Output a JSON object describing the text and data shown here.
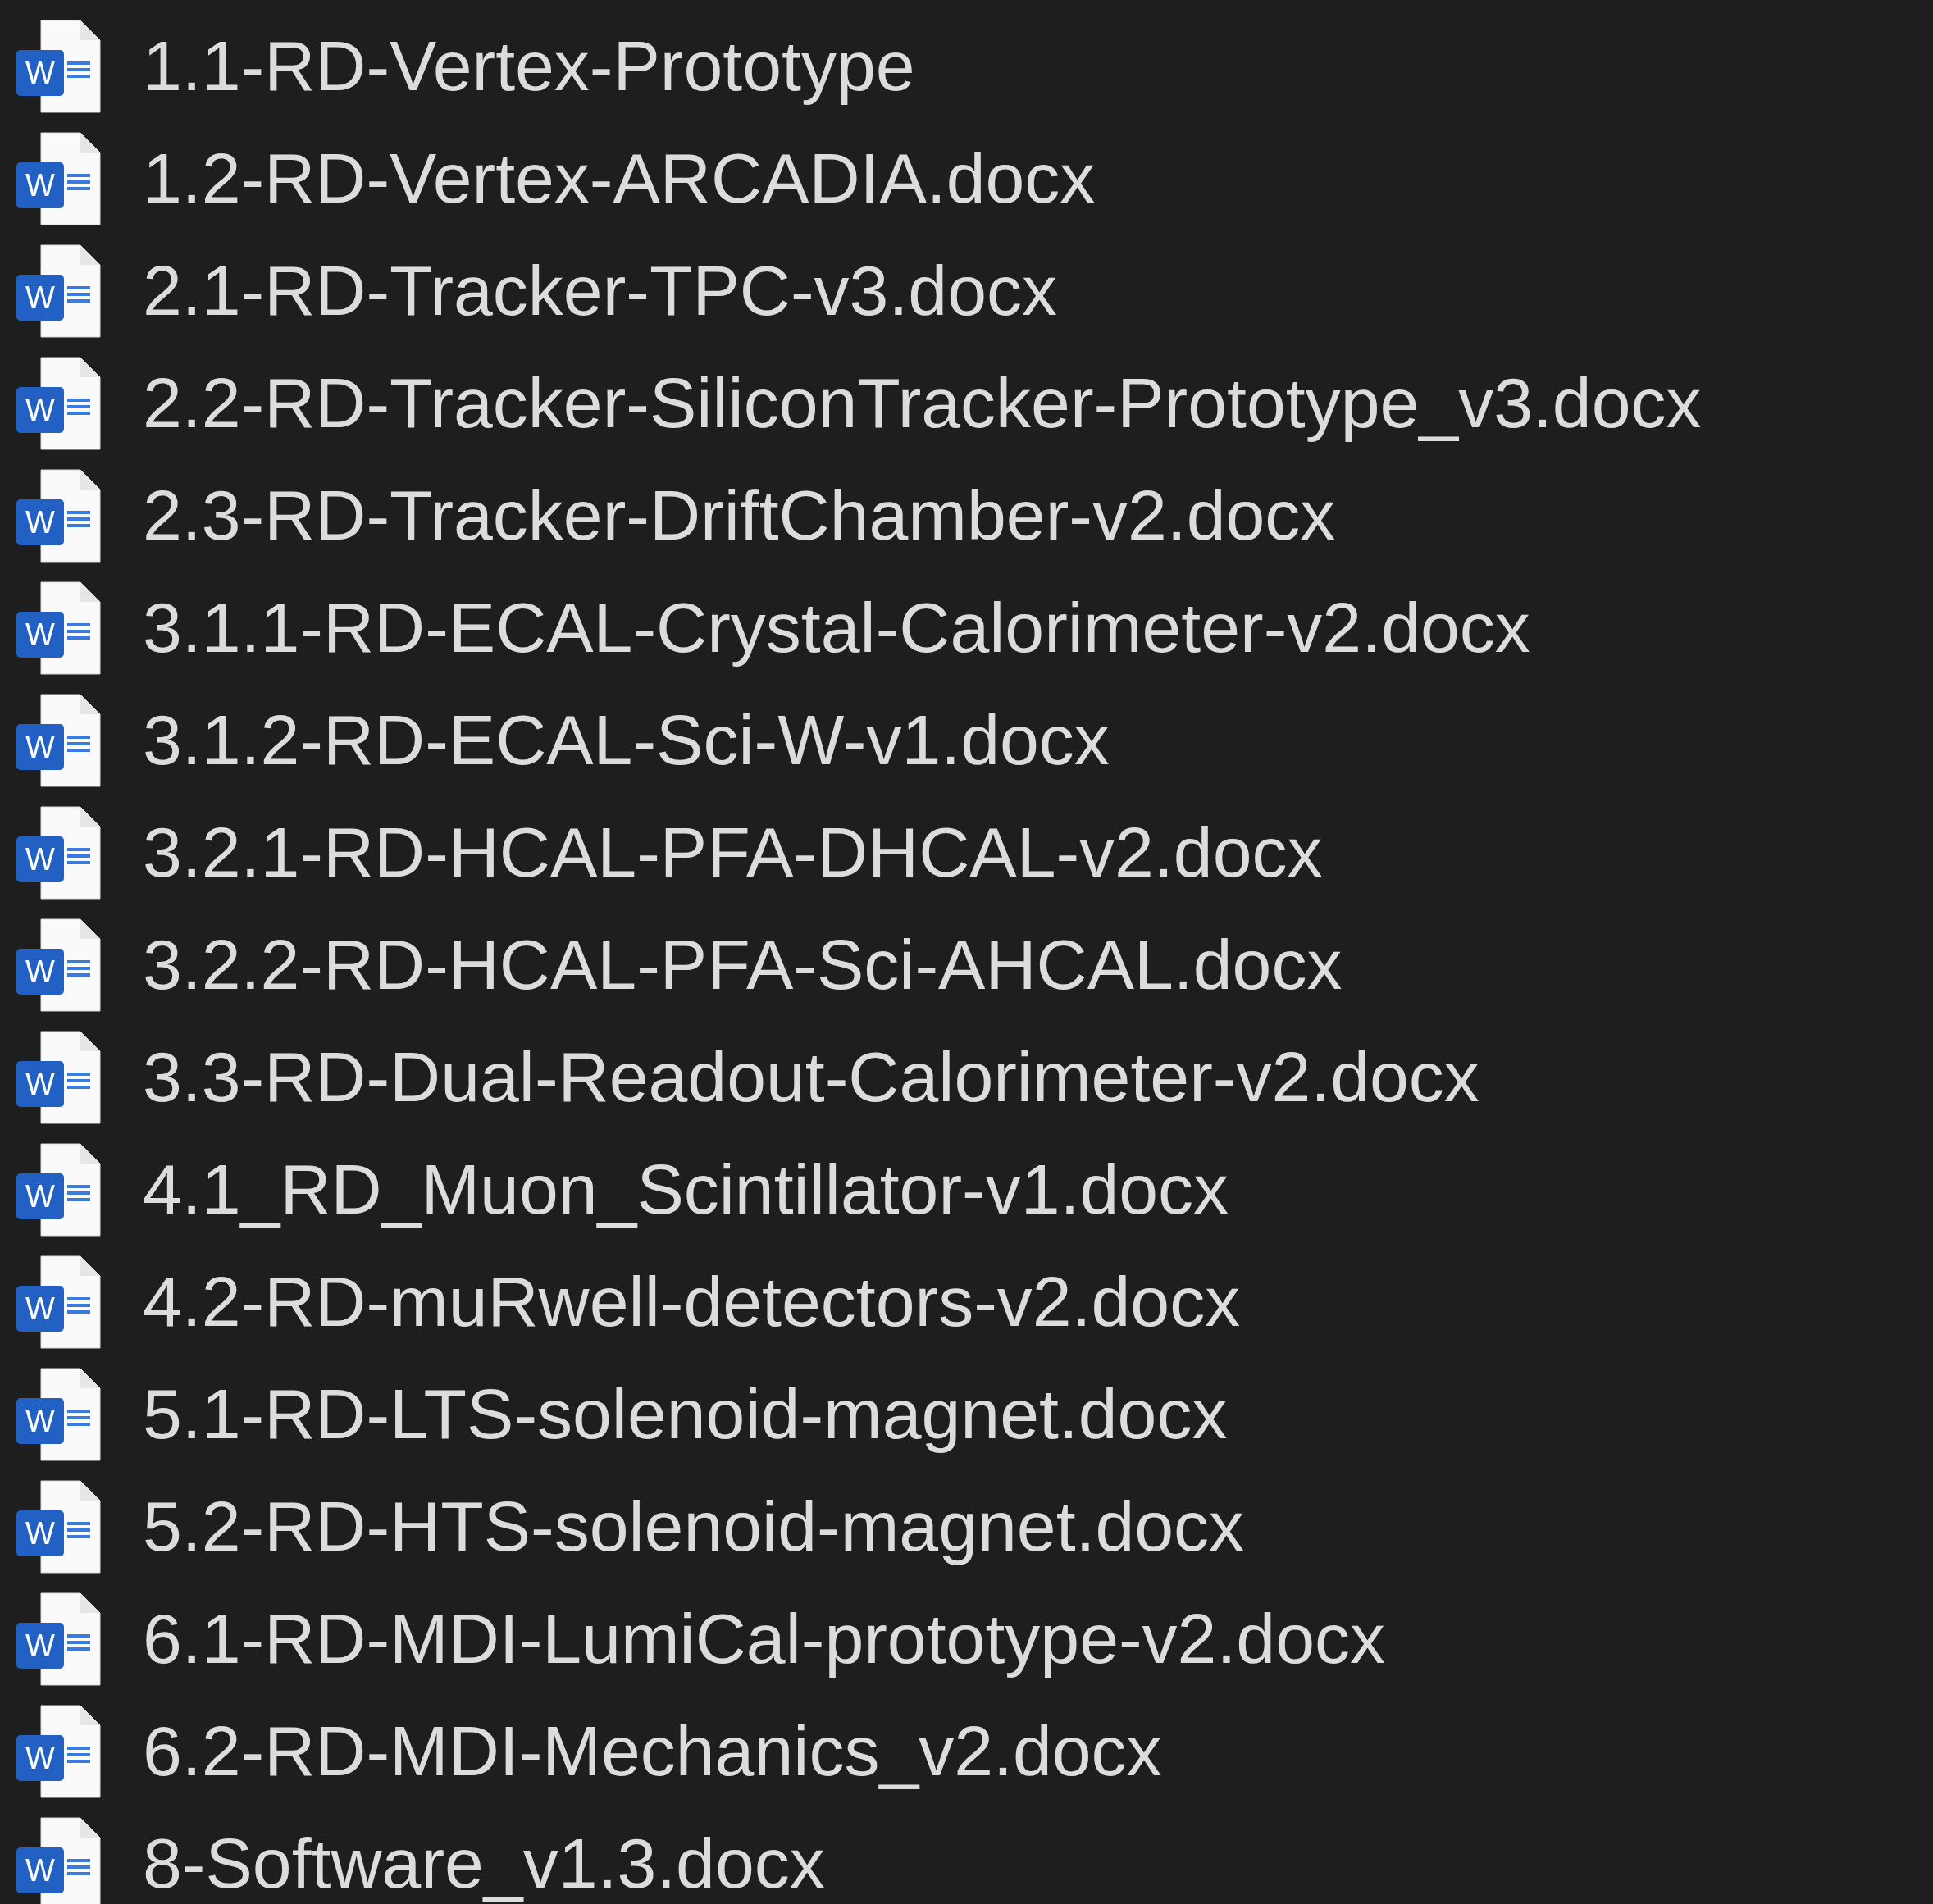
{
  "files": [
    {
      "name": "1.1-RD-Vertex-Prototype",
      "badge": "W"
    },
    {
      "name": "1.2-RD-Vertex-ARCADIA.docx",
      "badge": "W"
    },
    {
      "name": "2.1-RD-Tracker-TPC-v3.docx",
      "badge": "W"
    },
    {
      "name": "2.2-RD-Tracker-SiliconTracker-Prototype_v3.docx",
      "badge": "W"
    },
    {
      "name": "2.3-RD-Tracker-DriftChamber-v2.docx",
      "badge": "W"
    },
    {
      "name": "3.1.1-RD-ECAL-Crystal-Calorimeter-v2.docx",
      "badge": "W"
    },
    {
      "name": "3.1.2-RD-ECAL-Sci-W-v1.docx",
      "badge": "W"
    },
    {
      "name": "3.2.1-RD-HCAL-PFA-DHCAL-v2.docx",
      "badge": "W"
    },
    {
      "name": "3.2.2-RD-HCAL-PFA-Sci-AHCAL.docx",
      "badge": "W"
    },
    {
      "name": "3.3-RD-Dual-Readout-Calorimeter-v2.docx",
      "badge": "W"
    },
    {
      "name": "4.1_RD_Muon_Scintillator-v1.docx",
      "badge": "W"
    },
    {
      "name": "4.2-RD-muRwell-detectors-v2.docx",
      "badge": "W"
    },
    {
      "name": "5.1-RD-LTS-solenoid-magnet.docx",
      "badge": "W"
    },
    {
      "name": "5.2-RD-HTS-solenoid-magnet.docx",
      "badge": "W"
    },
    {
      "name": "6.1-RD-MDI-LumiCal-prototype-v2.docx",
      "badge": "W"
    },
    {
      "name": "6.2-RD-MDI-Mechanics_v2.docx",
      "badge": "W"
    },
    {
      "name": "8-Software_v1.3.docx",
      "badge": "W"
    }
  ]
}
